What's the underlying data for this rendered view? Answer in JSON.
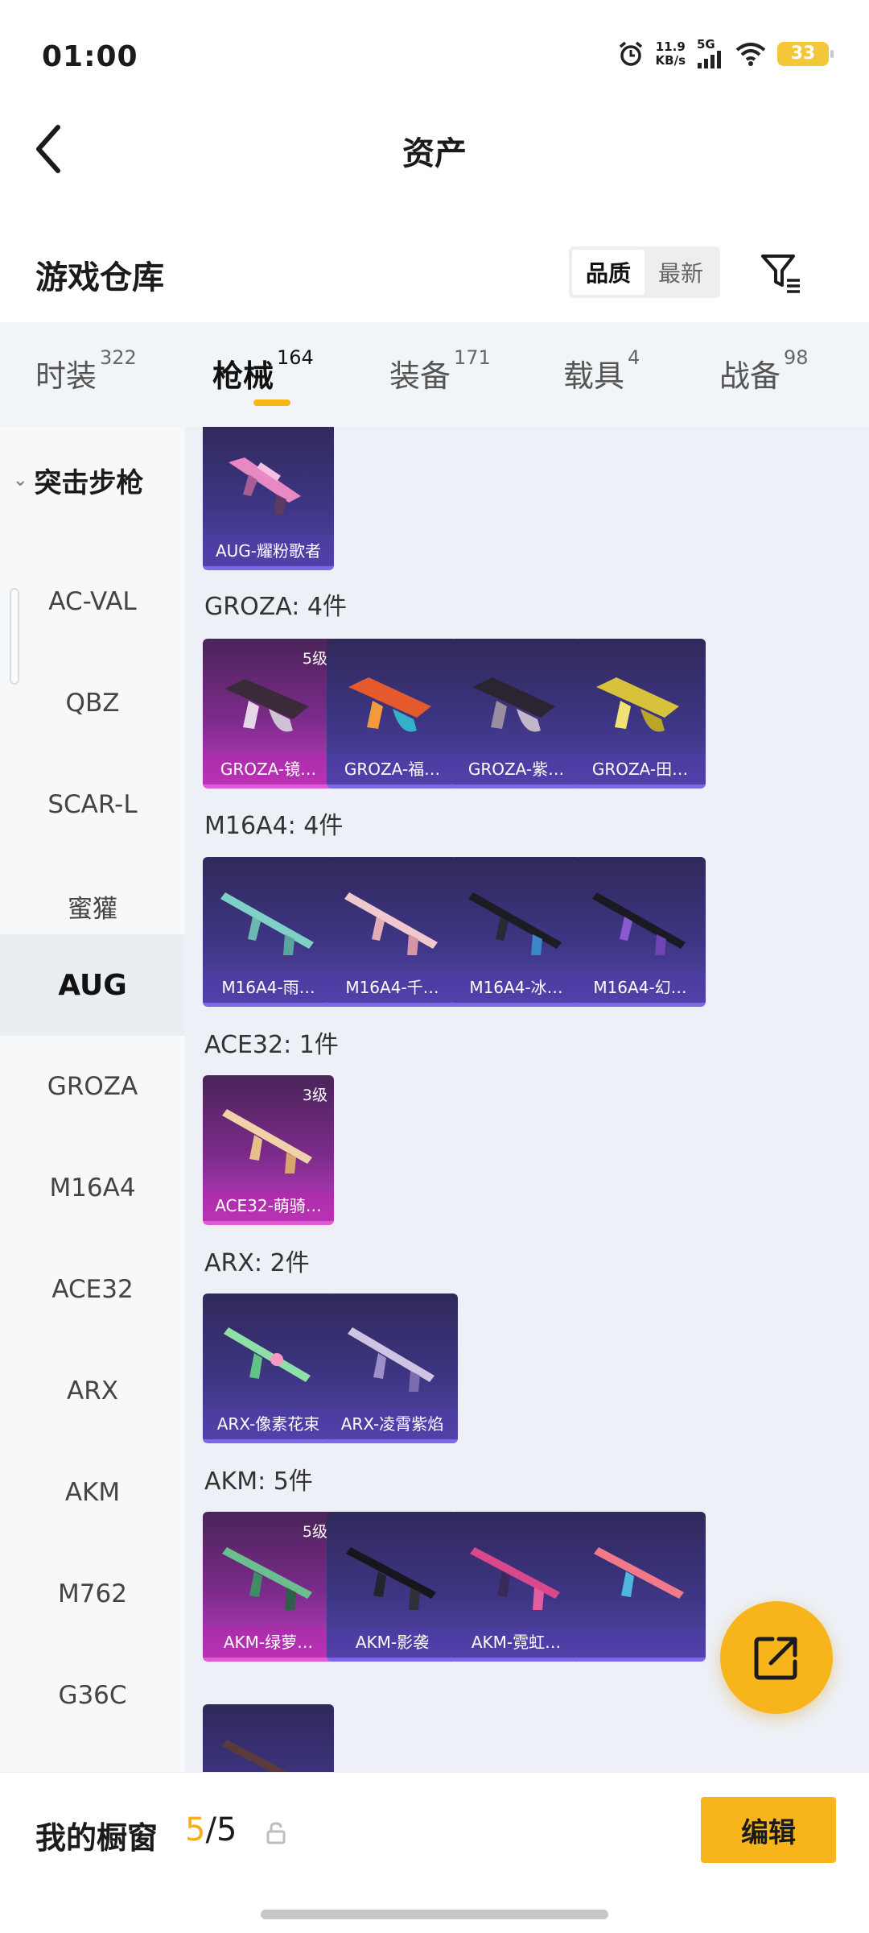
{
  "status_bar": {
    "time": "01:00",
    "speed_value": "11.9",
    "speed_unit": "KB/s",
    "network": "5G",
    "battery": "33"
  },
  "header": {
    "title": "资产",
    "back_icon": "chevron-left-icon"
  },
  "warehouse": {
    "title": "游戏仓库",
    "sort_options": [
      "品质",
      "最新"
    ],
    "sort_active": "品质",
    "filter_icon": "filter-icon"
  },
  "tabs": [
    {
      "label": "时装",
      "count": "322"
    },
    {
      "label": "枪械",
      "count": "164",
      "active": true
    },
    {
      "label": "装备",
      "count": "171"
    },
    {
      "label": "载具",
      "count": "4"
    },
    {
      "label": "战备",
      "count": "98"
    }
  ],
  "sidebar": {
    "group": "突击步枪",
    "items": [
      "AC-VAL",
      "QBZ",
      "SCAR-L",
      "蜜獾",
      "AUG",
      "GROZA",
      "M16A4",
      "ACE32",
      "ARX",
      "AKM",
      "M762",
      "G36C"
    ],
    "active": "AUG"
  },
  "sections": [
    {
      "title": "",
      "items": [
        {
          "label": "AUG-耀粉歌者",
          "level": ""
        }
      ]
    },
    {
      "title": "GROZA: 4件",
      "items": [
        {
          "label": "GROZA-镜…",
          "level": "5级"
        },
        {
          "label": "GROZA-福…",
          "level": ""
        },
        {
          "label": "GROZA-紫…",
          "level": ""
        },
        {
          "label": "GROZA-田…",
          "level": ""
        }
      ]
    },
    {
      "title": "M16A4: 4件",
      "items": [
        {
          "label": "M16A4-雨…",
          "level": ""
        },
        {
          "label": "M16A4-千…",
          "level": ""
        },
        {
          "label": "M16A4-冰…",
          "level": ""
        },
        {
          "label": "M16A4-幻…",
          "level": ""
        }
      ]
    },
    {
      "title": "ACE32: 1件",
      "items": [
        {
          "label": "ACE32-萌骑…",
          "level": "3级"
        }
      ]
    },
    {
      "title": "ARX: 2件",
      "items": [
        {
          "label": "ARX-像素花束",
          "level": ""
        },
        {
          "label": "ARX-凌霄紫焰",
          "level": ""
        }
      ]
    },
    {
      "title": "AKM: 5件",
      "items": [
        {
          "label": "AKM-绿萝…",
          "level": "5级"
        },
        {
          "label": "AKM-影袭",
          "level": ""
        },
        {
          "label": "AKM-霓虹…",
          "level": ""
        },
        {
          "label": "",
          "level": ""
        },
        {
          "label": "",
          "level": ""
        }
      ]
    }
  ],
  "colors": {
    "accent": "#f7b51b",
    "card_purple": "#3e3685",
    "card_pink": "#c03cbf"
  },
  "fab_icon": "share-out-icon",
  "bottom": {
    "showcase_label": "我的橱窗",
    "showcase_current": "5",
    "showcase_separator": "/",
    "showcase_total": "5",
    "lock_icon": "lock-icon",
    "edit_label": "编辑"
  }
}
